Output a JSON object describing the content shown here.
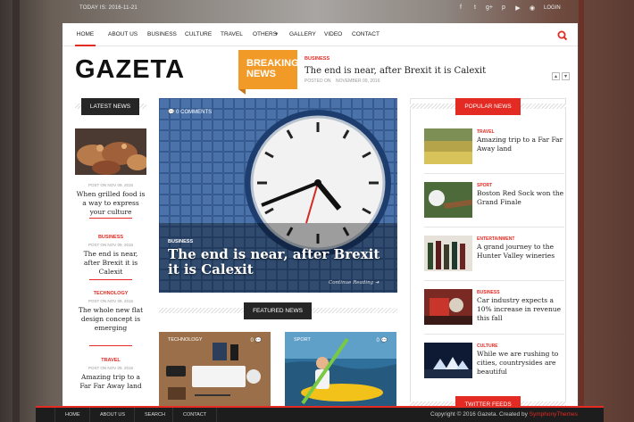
{
  "topbar": {
    "date": "TODAY IS: 2016-11-21",
    "social_icons": [
      "facebook-icon",
      "twitter-icon",
      "google-plus-icon",
      "pinterest-icon",
      "youtube-icon",
      "rss-icon"
    ],
    "social_glyphs": [
      "f",
      "t",
      "g+",
      "p",
      "▶",
      "◉"
    ],
    "login": "LOGIN"
  },
  "nav": {
    "items": [
      "HOME",
      "ABOUT US",
      "BUSINESS",
      "CULTURE",
      "TRAVEL",
      "OTHERS",
      "GALLERY",
      "VIDEO",
      "CONTACT"
    ],
    "others_arrow": "▾"
  },
  "logo": "GAZETA",
  "breaking": {
    "label": "BREAKING NEWS",
    "label_line1": "BREAKING",
    "label_line2": "NEWS",
    "category": "BUSINESS",
    "title": "The end is near, after Brexit it is Calexit",
    "posted_on": "POSTED ON",
    "date": "NOVEMBER 09, 2016",
    "prev": "<",
    "next": ">"
  },
  "latest": {
    "heading": "LATEST NEWS",
    "items": [
      {
        "category": "",
        "meta": "POST ON  NOV 09, 2016",
        "title": "When grilled food is a way to express your culture"
      },
      {
        "category": "BUSINESS",
        "meta": "POST ON  NOV 09, 2016",
        "title": "The end is near, after Brexit it is Calexit"
      },
      {
        "category": "TECHNOLOGY",
        "meta": "POST ON  NOV 09, 2016",
        "title": "The whole new flat design concept is emerging"
      },
      {
        "category": "TRAVEL",
        "meta": "POST ON  NOV 09, 2016",
        "title": "Amazing trip to a Far Far Away land"
      }
    ]
  },
  "hero": {
    "comments": "0 COMMENTS",
    "category": "BUSINESS",
    "title": "The end is near, after Brexit it is Calexit",
    "more": "Continue Reading"
  },
  "featured": {
    "heading": "FEATURED NEWS",
    "items": [
      {
        "category": "TECHNOLOGY",
        "count": "0"
      },
      {
        "category": "SPORT",
        "count": "0"
      }
    ]
  },
  "popular": {
    "heading": "POPULAR NEWS",
    "items": [
      {
        "category": "TRAVEL",
        "title": "Amazing trip to a Far Far Away land"
      },
      {
        "category": "SPORT",
        "title": "Boston Red Sock won the Grand Finale"
      },
      {
        "category": "ENTERTAINMENT",
        "title": "A grand journey to the Hunter Valley wineries"
      },
      {
        "category": "BUSINESS",
        "title": "Car industry expects a 10% increase in revenue this fall"
      },
      {
        "category": "CULTURE",
        "title": "While we are rushing to cities, countrysides are beautiful"
      }
    ]
  },
  "twitter": {
    "heading": "TWITTER FEEDS"
  },
  "footer": {
    "links": [
      "HOME",
      "ABOUT US",
      "SEARCH",
      "CONTACT"
    ],
    "copyright": "Copyright © 2016 Gazeta. Created by ",
    "brand": "SymphonyThemes"
  },
  "colors": {
    "accent": "#e32a23",
    "breaking": "#f29a27",
    "dark": "#262626"
  }
}
